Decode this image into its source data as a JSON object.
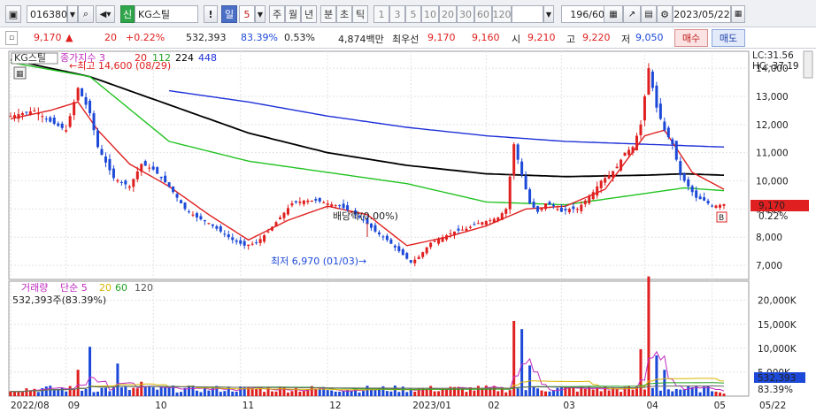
{
  "toolbar": {
    "code": "016380",
    "badge": "신",
    "name": "KG스틸",
    "warn": "!",
    "period_day": "일",
    "period_num": "5",
    "periods": [
      "주",
      "월",
      "년",
      "분",
      "초",
      "틱"
    ],
    "minutes": [
      "1",
      "3",
      "5",
      "10",
      "20",
      "30",
      "60",
      "120"
    ],
    "count": "196",
    "count_total": "/600",
    "date": "2023/05/22"
  },
  "quote": {
    "price": "9,170",
    "change": "20",
    "rate": "+0.22%",
    "volume": "532,393",
    "vol_ratio": "83.39%",
    "turnover": "0.53%",
    "amount": "4,874백만",
    "best_label": "최우선",
    "bid1": "9,170",
    "bid2": "9,160",
    "open_label": "시",
    "open": "9,210",
    "high_label": "고",
    "high": "9,220",
    "low_label": "저",
    "low": "9,050",
    "buy": "매수",
    "sell": "매도"
  },
  "chart": {
    "stock_tag": "KG스틸",
    "ma_title": "종가지수 3",
    "ma_periods": [
      "20",
      "112",
      "224",
      "448"
    ],
    "lc": "LC:31.56",
    "hc": "HC:-37.19",
    "high_note": "최고 14,600 (08/29)",
    "low_note": "최저 6,970 (01/03)",
    "div_note": "배당락(0.00%)",
    "last_price": "9,170",
    "last_rate": "0.22%",
    "b_mark": "B",
    "y_ticks": [
      "14,000",
      "13,000",
      "12,000",
      "11,000",
      "10,000",
      "9,000",
      "8,000",
      "7,000"
    ],
    "vol_title": "거래량",
    "vol_periods": [
      "단순 5",
      "20",
      "60",
      "120"
    ],
    "vol_value": "532,393주(83.39%)",
    "vol_ticks": [
      "20,000K",
      "15,000K",
      "10,000K",
      "5,000K"
    ],
    "vol_box": "532,393",
    "vol_box_rate": "83.39%",
    "x_ticks": [
      "2022/08",
      "09",
      "10",
      "11",
      "12",
      "2023/01",
      "02",
      "03",
      "04",
      "05",
      "05/22"
    ]
  },
  "colors": {
    "up": "#e02020",
    "down": "#1d49d8",
    "ma20": "#e02020",
    "ma112": "#22c322",
    "ma224": "#000000",
    "ma448": "#1d2fd8"
  },
  "chart_data": {
    "type": "candlestick",
    "x_start": "2022/08",
    "x_end": "05/22",
    "ylim": [
      6500,
      14600
    ],
    "price_path": [
      [
        0,
        12300
      ],
      [
        6,
        12500
      ],
      [
        10,
        12100
      ],
      [
        14,
        11800
      ],
      [
        17,
        13300
      ],
      [
        20,
        12400
      ],
      [
        22,
        11200
      ],
      [
        26,
        10100
      ],
      [
        30,
        9800
      ],
      [
        33,
        10600
      ],
      [
        36,
        10400
      ],
      [
        40,
        9800
      ],
      [
        44,
        9000
      ],
      [
        47,
        8700
      ],
      [
        50,
        8500
      ],
      [
        53,
        8200
      ],
      [
        56,
        7900
      ],
      [
        59,
        7700
      ],
      [
        62,
        7800
      ],
      [
        65,
        8200
      ],
      [
        68,
        8700
      ],
      [
        71,
        9200
      ],
      [
        74,
        9300
      ],
      [
        77,
        9300
      ],
      [
        80,
        9200
      ],
      [
        83,
        9100
      ],
      [
        86,
        8900
      ],
      [
        89,
        8600
      ],
      [
        92,
        8200
      ],
      [
        95,
        7900
      ],
      [
        98,
        7500
      ],
      [
        101,
        7100
      ],
      [
        103,
        7300
      ],
      [
        106,
        7800
      ],
      [
        109,
        8000
      ],
      [
        112,
        8200
      ],
      [
        115,
        8300
      ],
      [
        118,
        8500
      ],
      [
        121,
        8600
      ],
      [
        123,
        8700
      ],
      [
        125,
        9000
      ],
      [
        127,
        11300
      ],
      [
        129,
        10200
      ],
      [
        131,
        9200
      ],
      [
        133,
        8900
      ],
      [
        135,
        9200
      ],
      [
        137,
        9100
      ],
      [
        139,
        8900
      ],
      [
        141,
        9000
      ],
      [
        143,
        9000
      ],
      [
        145,
        9300
      ],
      [
        147,
        9600
      ],
      [
        149,
        10000
      ],
      [
        151,
        10200
      ],
      [
        153,
        10500
      ],
      [
        155,
        11000
      ],
      [
        157,
        11200
      ],
      [
        159,
        12000
      ],
      [
        161,
        14000
      ],
      [
        163,
        12600
      ],
      [
        165,
        11800
      ],
      [
        167,
        11300
      ],
      [
        169,
        10200
      ],
      [
        171,
        9800
      ],
      [
        173,
        9400
      ],
      [
        175,
        9300
      ],
      [
        177,
        9100
      ],
      [
        180,
        9170
      ]
    ],
    "ma20_path": [
      [
        0,
        12200
      ],
      [
        10,
        12500
      ],
      [
        17,
        12800
      ],
      [
        22,
        11800
      ],
      [
        30,
        10600
      ],
      [
        40,
        9800
      ],
      [
        50,
        8800
      ],
      [
        60,
        7900
      ],
      [
        70,
        8600
      ],
      [
        80,
        9100
      ],
      [
        90,
        8800
      ],
      [
        100,
        7700
      ],
      [
        110,
        8000
      ],
      [
        120,
        8400
      ],
      [
        130,
        9000
      ],
      [
        140,
        9100
      ],
      [
        150,
        9700
      ],
      [
        160,
        11600
      ],
      [
        165,
        11800
      ],
      [
        172,
        10300
      ],
      [
        180,
        9700
      ]
    ],
    "ma112_path": [
      [
        0,
        14200
      ],
      [
        20,
        13700
      ],
      [
        40,
        11400
      ],
      [
        60,
        10700
      ],
      [
        80,
        10300
      ],
      [
        100,
        9900
      ],
      [
        120,
        9250
      ],
      [
        140,
        9150
      ],
      [
        160,
        9550
      ],
      [
        170,
        9750
      ],
      [
        180,
        9650
      ]
    ],
    "ma224_path": [
      [
        0,
        14300
      ],
      [
        20,
        13700
      ],
      [
        40,
        12700
      ],
      [
        60,
        11700
      ],
      [
        80,
        11000
      ],
      [
        100,
        10550
      ],
      [
        120,
        10250
      ],
      [
        140,
        10150
      ],
      [
        160,
        10200
      ],
      [
        170,
        10250
      ],
      [
        180,
        10200
      ]
    ],
    "ma448_path": [
      [
        40,
        13200
      ],
      [
        60,
        12800
      ],
      [
        80,
        12300
      ],
      [
        100,
        11900
      ],
      [
        120,
        11600
      ],
      [
        140,
        11400
      ],
      [
        160,
        11300
      ],
      [
        180,
        11200
      ]
    ],
    "volume_ylim": [
      0,
      24000
    ],
    "volume_spikes_k": [
      [
        17,
        5500
      ],
      [
        20,
        10300
      ],
      [
        27,
        6800
      ],
      [
        33,
        3000
      ],
      [
        127,
        15700
      ],
      [
        129,
        14000
      ],
      [
        131,
        6400
      ],
      [
        159,
        9800
      ],
      [
        161,
        25000
      ],
      [
        163,
        8500
      ],
      [
        165,
        5500
      ]
    ],
    "volume_base_k": 1500,
    "volume_end_k": 532
  }
}
